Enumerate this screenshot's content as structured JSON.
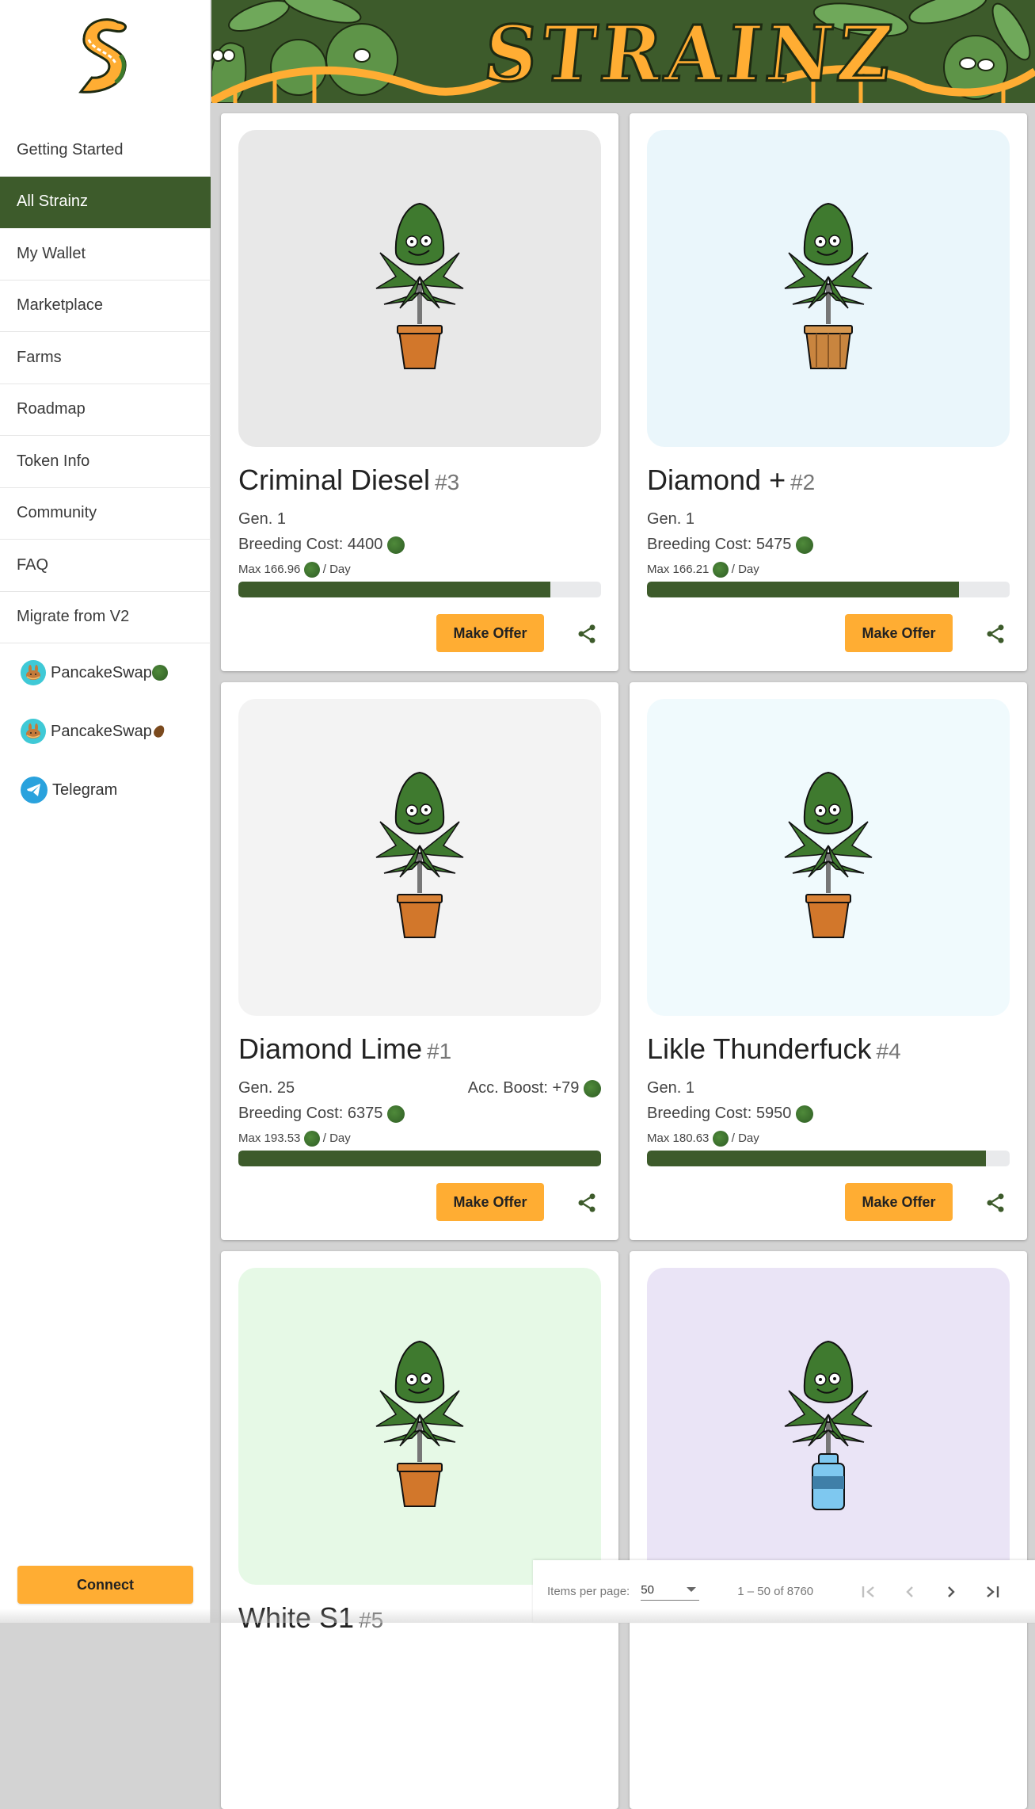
{
  "app": {
    "title": "STRAINZ"
  },
  "sidebar": {
    "logo": "strainz-s-logo",
    "items": [
      {
        "label": "Getting Started",
        "active": false
      },
      {
        "label": "All Strainz",
        "active": true
      },
      {
        "label": "My Wallet",
        "active": false
      },
      {
        "label": "Marketplace",
        "active": false
      },
      {
        "label": "Farms",
        "active": false
      },
      {
        "label": "Roadmap",
        "active": false
      },
      {
        "label": "Token Info",
        "active": false
      },
      {
        "label": "Community",
        "active": false
      },
      {
        "label": "FAQ",
        "active": false
      },
      {
        "label": "Migrate from V2",
        "active": false
      }
    ],
    "links": [
      {
        "label": "PancakeSwap",
        "icon": "pancakeswap-icon",
        "suffix_icon": "strainz-token-icon"
      },
      {
        "label": "PancakeSwap",
        "icon": "pancakeswap-icon",
        "suffix_icon": "seedz-token-icon"
      },
      {
        "label": "Telegram",
        "icon": "telegram-icon"
      }
    ],
    "connect_label": "Connect"
  },
  "cards": [
    {
      "name": "Criminal Diesel",
      "number": "#3",
      "gen": "Gen. 1",
      "boost": null,
      "breeding_cost": "Breeding Cost: 4400",
      "max_label": "Max 166.96",
      "per_day": "/ Day",
      "progress": 0.86,
      "image_bg": "#e8e8e8",
      "pot": "clay",
      "offer_label": "Make Offer"
    },
    {
      "name": "Diamond +",
      "number": "#2",
      "gen": "Gen. 1",
      "boost": null,
      "breeding_cost": "Breeding Cost: 5475",
      "max_label": "Max 166.21",
      "per_day": "/ Day",
      "progress": 0.86,
      "image_bg": "#eaf6fb",
      "pot": "basket",
      "offer_label": "Make Offer"
    },
    {
      "name": "Diamond Lime",
      "number": "#1",
      "gen": "Gen. 25",
      "boost": "Acc. Boost: +79",
      "breeding_cost": "Breeding Cost: 6375",
      "max_label": "Max 193.53",
      "per_day": "/ Day",
      "progress": 1.0,
      "image_bg": "#f3f3f3",
      "pot": "clay",
      "offer_label": "Make Offer"
    },
    {
      "name": "Likle Thunderfuck",
      "number": "#4",
      "gen": "Gen. 1",
      "boost": null,
      "breeding_cost": "Breeding Cost: 5950",
      "max_label": "Max 180.63",
      "per_day": "/ Day",
      "progress": 0.935,
      "image_bg": "#f0fafd",
      "pot": "clay",
      "offer_label": "Make Offer"
    },
    {
      "name": "White S1",
      "number": "#5",
      "image_bg": "#e6f9e6",
      "pot": "clay"
    },
    {
      "name": "",
      "number": "",
      "image_bg": "#eae4f6",
      "pot": "bottle"
    }
  ],
  "paginator": {
    "items_per_page_label": "Items per page:",
    "items_per_page": "50",
    "range": "1 – 50 of 8760",
    "first_disabled": true,
    "prev_disabled": true,
    "next_disabled": false,
    "last_disabled": false
  },
  "colors": {
    "primary_green": "#3d5b2b",
    "accent_orange": "#ffad33"
  }
}
